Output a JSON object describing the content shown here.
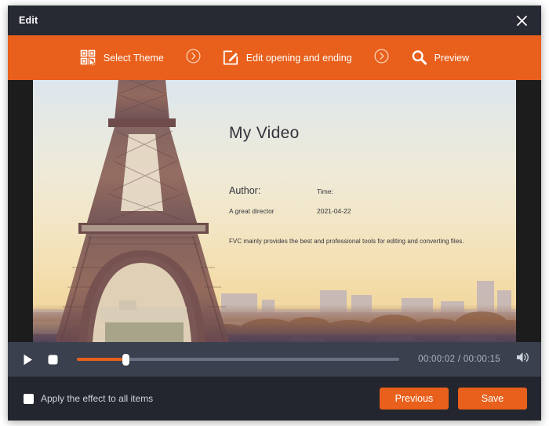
{
  "window": {
    "title": "Edit",
    "close_icon": "close-icon"
  },
  "toolbar": {
    "accent_color": "#e8601c",
    "items": [
      {
        "label": "Select Theme",
        "icon": "theme-grid-icon"
      },
      {
        "label": "Edit opening and ending",
        "icon": "pencil-square-icon"
      },
      {
        "label": "Preview",
        "icon": "magnifier-icon"
      }
    ],
    "separator_icon": "chevron-right-circle-icon"
  },
  "preview": {
    "title": "My Video",
    "author_label": "Author:",
    "author_value": "A great director",
    "time_label": "Time:",
    "time_value": "2021-04-22",
    "description": "FVC mainly provides the best and professional tools for editing and converting files."
  },
  "player": {
    "play_icon": "play-icon",
    "stop_icon": "stop-icon",
    "volume_icon": "volume-icon",
    "current_time": "00:00:02",
    "separator": "/",
    "total_time": "00:00:15",
    "progress_percent": 15
  },
  "footer": {
    "checkbox_label": "Apply the effect to all items",
    "checkbox_checked": false,
    "previous_label": "Previous",
    "save_label": "Save"
  }
}
